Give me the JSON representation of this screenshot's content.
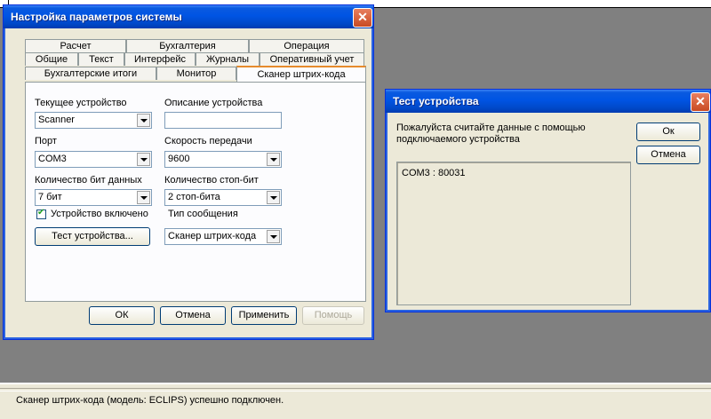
{
  "settings_window": {
    "title": "Настройка параметров системы",
    "tabs_row1": [
      "Расчет",
      "Бухгалтерия",
      "Операция"
    ],
    "tabs_row2": [
      "Общие",
      "Текст",
      "Интерфейс",
      "Журналы",
      "Оперативный учет"
    ],
    "tabs_row3": [
      "Бухгалтерские итоги",
      "Монитор",
      "Сканер штрих-кода"
    ],
    "selected_tab": "Сканер штрих-кода",
    "current_device_label": "Текущее устройство",
    "current_device_value": "Scanner",
    "device_description_label": "Описание устройства",
    "device_description_value": "",
    "port_label": "Порт",
    "port_value": "COM3",
    "baud_label": "Скорость передачи",
    "baud_value": "9600",
    "data_bits_label": "Количество бит данных",
    "data_bits_value": "7 бит",
    "stop_bits_label": "Количество стоп-бит",
    "stop_bits_value": "2 стоп-бита",
    "device_enabled_label": "Устройство включено",
    "device_enabled_checked": true,
    "message_type_label": "Тип сообщения",
    "message_type_value": "Сканер штрих-кода",
    "test_button": "Тест устройства...",
    "ok_button": "ОК",
    "cancel_button": "Отмена",
    "apply_button": "Применить",
    "help_button": "Помощь"
  },
  "test_window": {
    "title": "Тест устройства",
    "instruction": "Пожалуйста считайте данные с помощью подключаемого устройства",
    "ok_button": "Ок",
    "cancel_button": "Отмена",
    "output": "COM3 : 80031"
  },
  "status_bar": {
    "text": "Сканер штрих-кода (модель: ECLIPS) успешно подключен."
  },
  "colors": {
    "titlebar": "#0054e3",
    "desktop": "#808080",
    "dialog_face": "#ece9d8"
  }
}
